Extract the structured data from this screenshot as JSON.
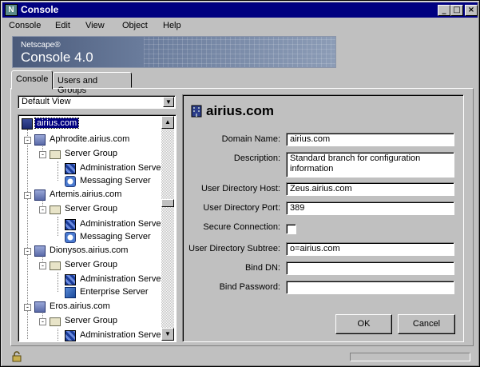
{
  "window": {
    "title": "Console",
    "app_icon": "N"
  },
  "menu": [
    "Console",
    "Edit",
    "View",
    "Object",
    "Help"
  ],
  "banner": {
    "brand": "Netscape®",
    "product": "Console 4.0"
  },
  "tabs": [
    {
      "label": "Console",
      "active": true
    },
    {
      "label": "Users and Groups",
      "active": false
    }
  ],
  "view_select": {
    "value": "Default View"
  },
  "tree": [
    {
      "label": "airius.com",
      "icon": "domain-icon",
      "selected": true
    },
    {
      "label": "Aphrodite.airius.com",
      "icon": "host-icon"
    },
    {
      "label": "Server Group",
      "icon": "folder-icon"
    },
    {
      "label": "Administration Server",
      "icon": "admin-server-icon"
    },
    {
      "label": "Messaging Server",
      "icon": "messaging-server-icon"
    },
    {
      "label": "Artemis.airius.com",
      "icon": "host-icon"
    },
    {
      "label": "Server Group",
      "icon": "folder-icon"
    },
    {
      "label": "Administration Server",
      "icon": "admin-server-icon"
    },
    {
      "label": "Messaging Server",
      "icon": "messaging-server-icon"
    },
    {
      "label": "Dionysos.airius.com",
      "icon": "host-icon"
    },
    {
      "label": "Server Group",
      "icon": "folder-icon"
    },
    {
      "label": "Administration Server",
      "icon": "admin-server-icon"
    },
    {
      "label": "Enterprise Server",
      "icon": "enterprise-server-icon"
    },
    {
      "label": "Eros.airius.com",
      "icon": "host-icon"
    },
    {
      "label": "Server Group",
      "icon": "folder-icon"
    },
    {
      "label": "Administration Server",
      "icon": "admin-server-icon"
    }
  ],
  "detail": {
    "title": "airius.com",
    "fields": {
      "domain_name": {
        "label": "Domain Name:",
        "value": "airius.com"
      },
      "description": {
        "label": "Description:",
        "value": "Standard branch for configuration information"
      },
      "user_dir_host": {
        "label": "User Directory Host:",
        "value": "Zeus.airius.com"
      },
      "user_dir_port": {
        "label": "User Directory Port:",
        "value": "389"
      },
      "secure_connection": {
        "label": "Secure Connection:",
        "checked": false
      },
      "user_dir_subtree": {
        "label": "User Directory Subtree:",
        "value": "o=airius.com"
      },
      "bind_dn": {
        "label": "Bind DN:",
        "value": ""
      },
      "bind_password": {
        "label": "Bind Password:",
        "value": ""
      }
    },
    "ok_label": "OK",
    "cancel_label": "Cancel"
  },
  "colors": {
    "titlebar": "#000080",
    "face": "#c0c0c0",
    "selection": "#000080"
  }
}
